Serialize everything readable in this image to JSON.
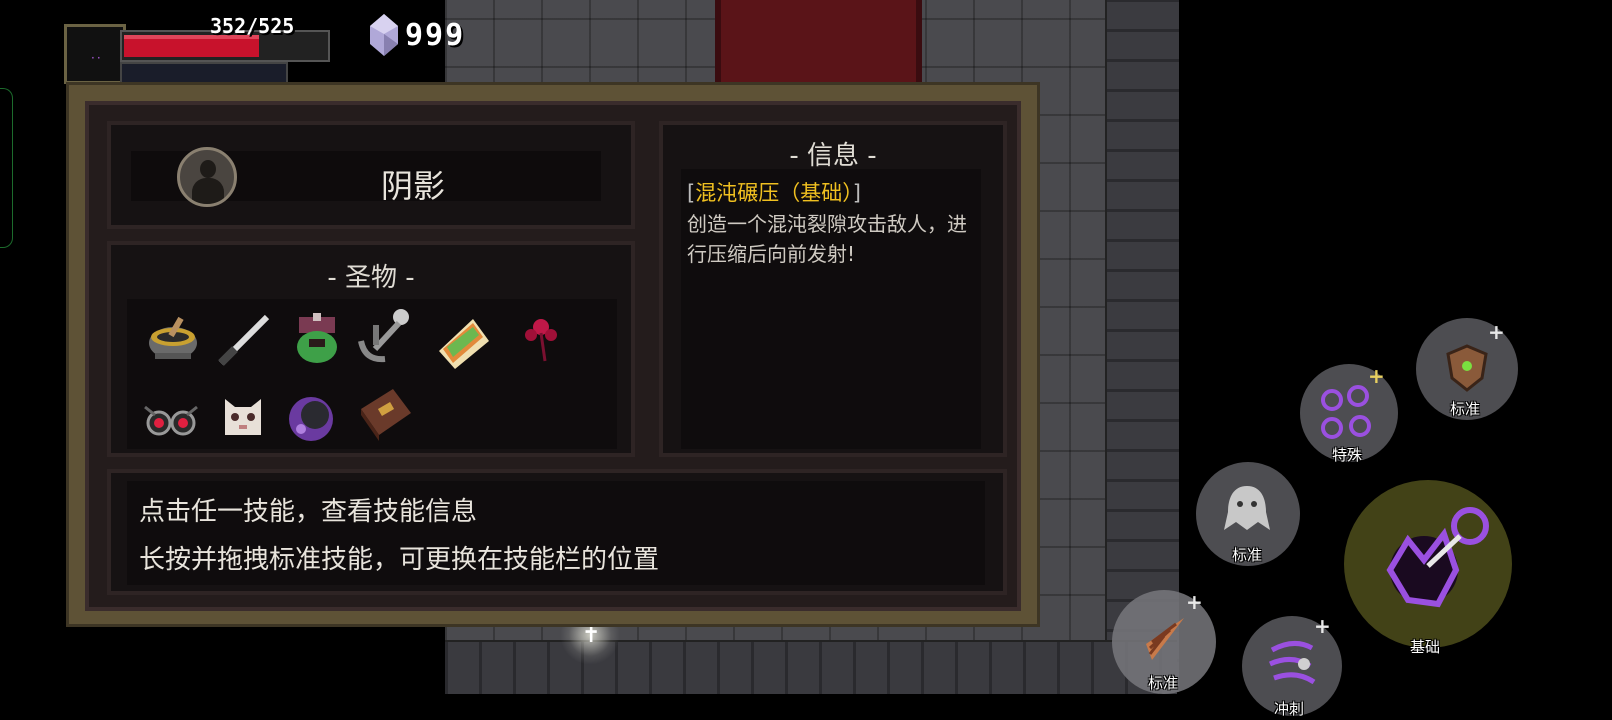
{
  "hud": {
    "hp_text": "352/525",
    "hp_current": 352,
    "hp_max": 525,
    "gem_count": "999",
    "colors": {
      "hp": "#c8122c",
      "gem": "#b0a8d8"
    }
  },
  "panel": {
    "character": {
      "name": "阴影"
    },
    "relics": {
      "title": "- 圣物 -",
      "items": [
        {
          "icon": "mortar-bowl-icon"
        },
        {
          "icon": "dagger-icon"
        },
        {
          "icon": "green-potion-pot-icon"
        },
        {
          "icon": "anchor-skull-icon"
        },
        {
          "icon": "sandwich-icon"
        },
        {
          "icon": "red-flower-icon"
        },
        {
          "icon": "red-goggles-icon"
        },
        {
          "icon": "white-cat-mask-icon"
        },
        {
          "icon": "purple-crystal-bomb-icon"
        },
        {
          "icon": "spell-book-icon"
        }
      ]
    },
    "info": {
      "title": "- 信息 -",
      "skill_open": "[",
      "skill_name": "混沌碾压（基础）",
      "skill_close": "]",
      "description": "创造一个混沌裂隙攻击敌人，进行压缩后向前发射!"
    },
    "hints": {
      "line1": "点击任一技能，查看技能信息",
      "line2": "长按并拖拽标准技能，可更换在技能栏的位置"
    }
  },
  "skills": {
    "shield": {
      "label": "标准",
      "icon": "shield-icon"
    },
    "special": {
      "label": "特殊",
      "icon": "purple-orbs-icon"
    },
    "ghost": {
      "label": "标准",
      "icon": "ghost-icon"
    },
    "basic": {
      "label": "基础",
      "icon": "chaos-rift-icon"
    },
    "drill": {
      "label": "标准",
      "icon": "drill-shell-icon"
    },
    "dash": {
      "label": "冲刺",
      "icon": "purple-dash-icon"
    },
    "plus": "+"
  }
}
